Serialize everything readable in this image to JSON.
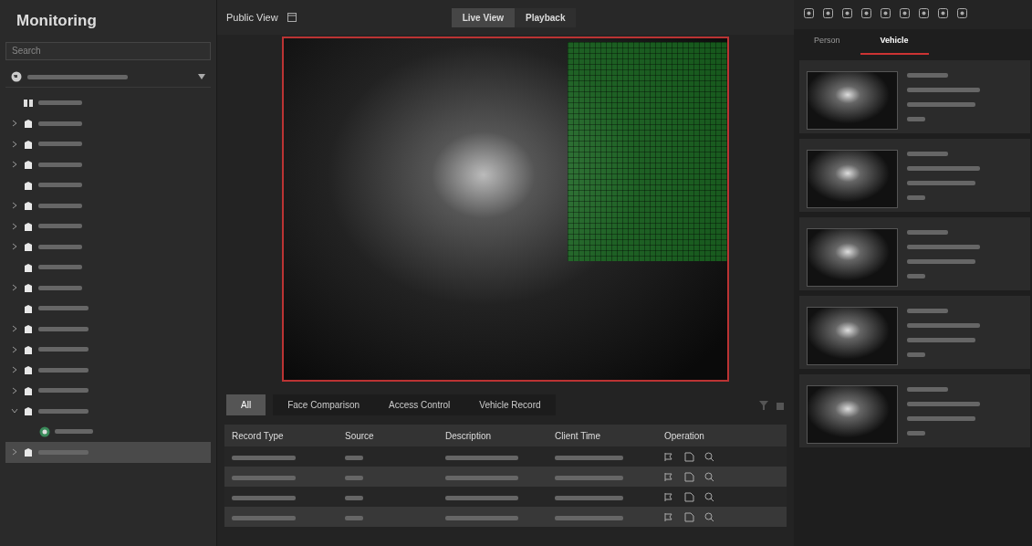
{
  "sidebar": {
    "title": "Monitoring",
    "search": {
      "placeholder": "Search"
    },
    "tree": [
      {
        "kind": "view",
        "selected": false
      },
      {
        "kind": "site",
        "expanded": false,
        "selected": false
      },
      {
        "kind": "site",
        "expanded": false,
        "selected": false
      },
      {
        "kind": "site",
        "expanded": false,
        "selected": false
      },
      {
        "kind": "site",
        "selected": false
      },
      {
        "kind": "site",
        "expanded": false,
        "selected": false
      },
      {
        "kind": "site",
        "expanded": false,
        "selected": false
      },
      {
        "kind": "site",
        "expanded": false,
        "selected": false
      },
      {
        "kind": "site",
        "selected": false
      },
      {
        "kind": "site",
        "expanded": false,
        "selected": false
      },
      {
        "kind": "site",
        "selected": false
      },
      {
        "kind": "site",
        "expanded": false,
        "selected": false
      },
      {
        "kind": "site",
        "expanded": false,
        "selected": false
      },
      {
        "kind": "site",
        "expanded": false,
        "selected": false
      },
      {
        "kind": "site",
        "expanded": false,
        "selected": false
      },
      {
        "kind": "site",
        "expanded": true,
        "selected": false,
        "children": [
          {
            "kind": "camera",
            "selected": false
          }
        ]
      },
      {
        "kind": "site",
        "expanded": false,
        "selected": true
      }
    ]
  },
  "view": {
    "title": "Public View",
    "modes": [
      {
        "label": "Live View",
        "selected": true
      },
      {
        "label": "Playback",
        "selected": false
      }
    ]
  },
  "events": {
    "tabs": [
      {
        "label": "All",
        "selected": true
      },
      {
        "label": "Face Comparison",
        "selected": false
      },
      {
        "label": "Access Control",
        "selected": false
      },
      {
        "label": "Vehicle Record",
        "selected": false
      }
    ],
    "columns": [
      "Record Type",
      "Source",
      "Description",
      "Client Time",
      "Operation"
    ],
    "rows": [
      {
        "kind": "event"
      },
      {
        "kind": "event"
      },
      {
        "kind": "event"
      },
      {
        "kind": "event"
      }
    ]
  },
  "captures": {
    "tabs": [
      {
        "label": "Person",
        "selected": false
      },
      {
        "label": "Vehicle",
        "selected": true
      }
    ],
    "cards": [
      {
        "kind": "vehicle"
      },
      {
        "kind": "vehicle"
      },
      {
        "kind": "vehicle"
      },
      {
        "kind": "vehicle"
      },
      {
        "kind": "vehicle"
      }
    ]
  }
}
